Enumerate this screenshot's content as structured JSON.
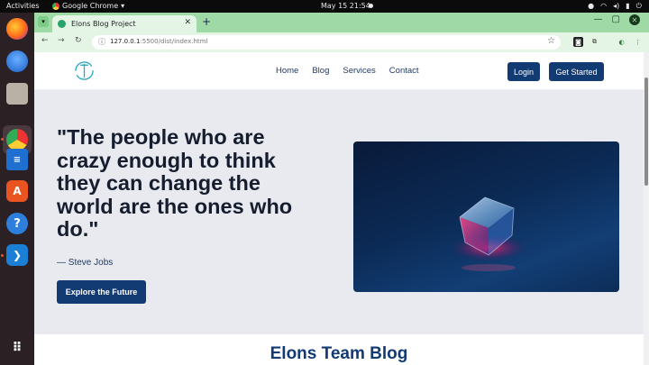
{
  "system_bar": {
    "activities": "Activities",
    "app_name": "Google Chrome",
    "clock": "May 15  21:54"
  },
  "browser": {
    "tab_title": "Elons Blog Project",
    "url_host": "127.0.0.1",
    "url_path": ":5500/dist/index.html"
  },
  "site": {
    "nav": [
      "Home",
      "Blog",
      "Services",
      "Contact"
    ],
    "login_label": "Login",
    "get_started_label": "Get Started",
    "hero": {
      "quote": "\"The people who are crazy enough to think they can change the world are the ones who do.\"",
      "author": "— Steve Jobs",
      "cta_label": "Explore the Future"
    },
    "section_title": "Elons Team Blog"
  },
  "colors": {
    "brand": "#123a73",
    "tab_strip": "#9fdaa6",
    "page_bg": "#e8eaef"
  }
}
